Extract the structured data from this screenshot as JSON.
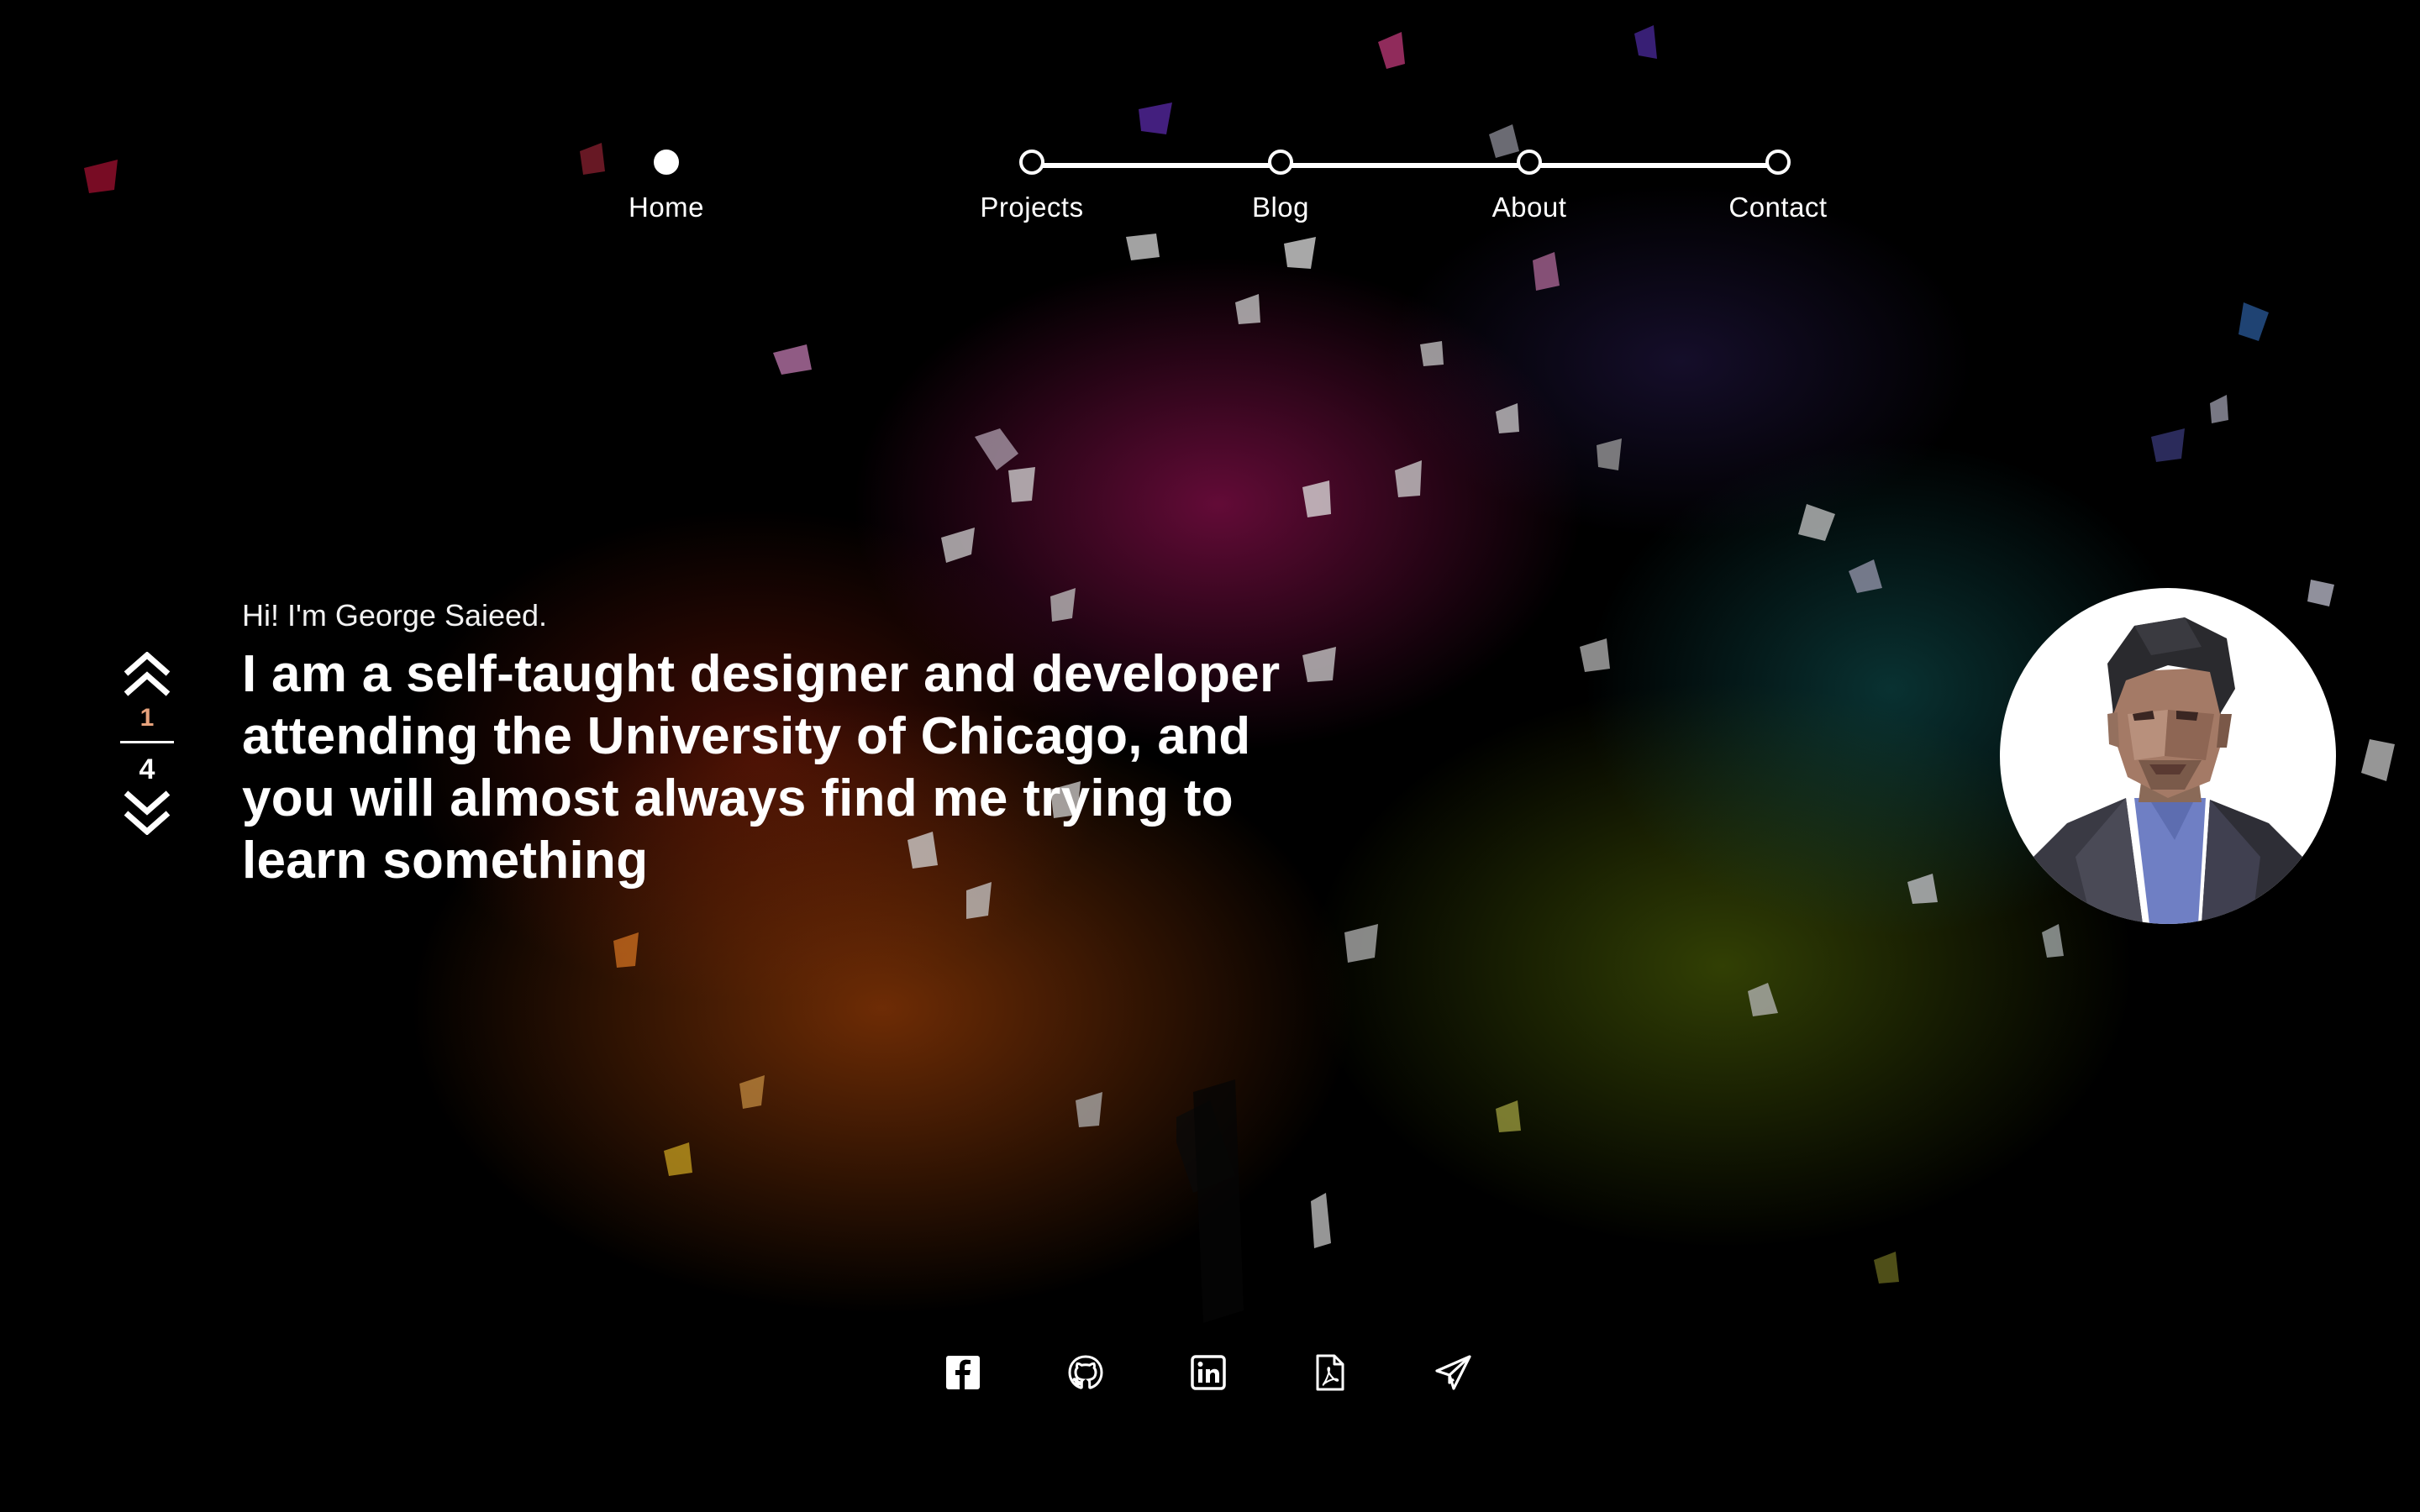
{
  "nav": {
    "items": [
      {
        "label": "Home",
        "active": true
      },
      {
        "label": "Projects",
        "active": false
      },
      {
        "label": "Blog",
        "active": false
      },
      {
        "label": "About",
        "active": false
      },
      {
        "label": "Contact",
        "active": false
      }
    ]
  },
  "hero": {
    "greeting": "Hi! I'm George Saieed.",
    "headline_lines": [
      "I am a self-taught designer and developer",
      "attending the University of Chicago, and",
      "you will almost always find me trying to",
      "learn something"
    ]
  },
  "pager": {
    "current": "1",
    "total": "4",
    "up_icon": "double-chevron-up-icon",
    "down_icon": "double-chevron-down-icon"
  },
  "avatar": {
    "icon": "low-poly-portrait"
  },
  "social": {
    "icons": [
      "facebook-icon",
      "github-icon",
      "linkedin-icon",
      "pdf-resume-icon",
      "paper-plane-icon"
    ]
  },
  "colors": {
    "background": "#000000",
    "text": "#ffffff",
    "pager_current": "#e7a27c",
    "avatar_bg": "#ffffff"
  }
}
